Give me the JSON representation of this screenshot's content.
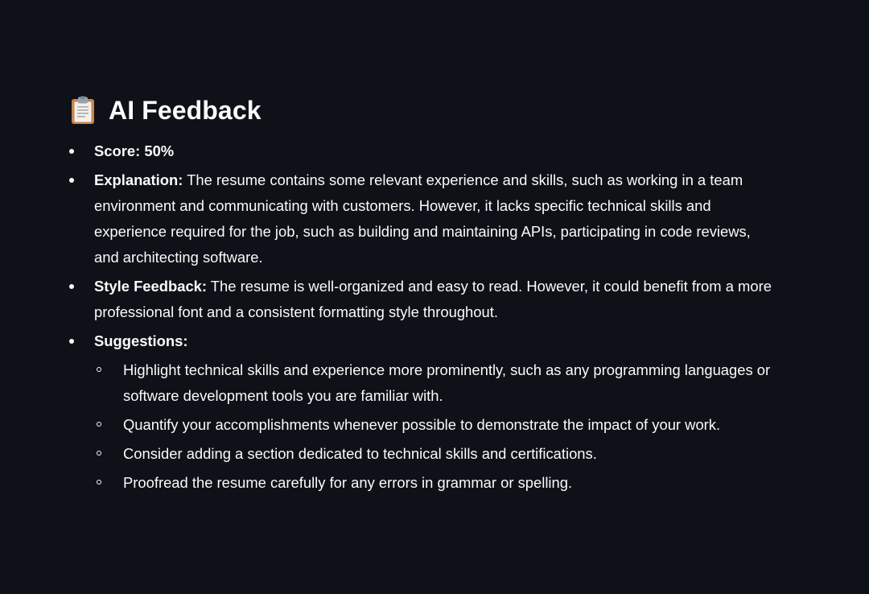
{
  "header": {
    "icon": "clipboard-icon",
    "title": "AI Feedback"
  },
  "feedback": {
    "score": {
      "label": "Score: 50%"
    },
    "explanation": {
      "label": "Explanation:",
      "text": " The resume contains some relevant experience and skills, such as working in a team environment and communicating with customers. However, it lacks specific technical skills and experience required for the job, such as building and maintaining APIs, participating in code reviews, and architecting software."
    },
    "style": {
      "label": "Style Feedback:",
      "text": " The resume is well-organized and easy to read. However, it could benefit from a more professional font and a consistent formatting style throughout."
    },
    "suggestions": {
      "label": "Suggestions:",
      "items": [
        "Highlight technical skills and experience more prominently, such as any programming languages or software development tools you are familiar with.",
        "Quantify your accomplishments whenever possible to demonstrate the impact of your work.",
        "Consider adding a section dedicated to technical skills and certifications.",
        "Proofread the resume carefully for any errors in grammar or spelling."
      ]
    }
  }
}
